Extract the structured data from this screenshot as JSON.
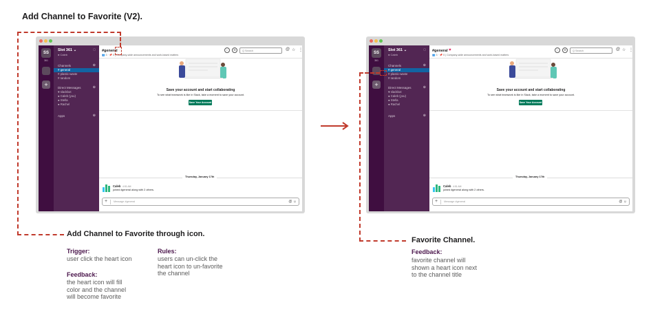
{
  "page_title": "Add Channel to Favorite (V2).",
  "mock": {
    "workspace_initials": "SS",
    "workspace_sub": "361",
    "workspace_name": "Slot 361 ⌄",
    "user_status": "● Caleb",
    "sections": {
      "channels": "Channels",
      "direct_messages": "Direct Messages",
      "apps": "Apps"
    },
    "channels": [
      "# general",
      "# plastic-waste",
      "# random"
    ],
    "dms": [
      "♥ slackbot",
      "● Caleb (you)",
      "● Stella",
      "● Rachel"
    ],
    "channel_title": "#general",
    "channel_desc": "👥 3 · 📌 0 | Company-wide announcements and work-based matters",
    "search_placeholder": "Q  Search",
    "onboarding": {
      "title": "Save your account and start collaborating",
      "body": "To see what teamwork is like in Slack, take a moment to save your account.",
      "button": "Save Your Account"
    },
    "date_divider": "Thursday, January 17th",
    "message": {
      "author": "Caleb",
      "time": "4:51 AM",
      "text": "joined #general along with 2 others."
    },
    "composer_placeholder": "Message #general"
  },
  "annotations": {
    "left": {
      "title": "Add Channel to Favorite through icon.",
      "trigger_label": "Trigger:",
      "trigger_text": [
        "user click the heart icon"
      ],
      "rules_label": "Rules:",
      "rules_text": [
        "users can un-click the",
        "heart icon to un-favorite",
        "the channel"
      ],
      "feedback_label": "Feedback:",
      "feedback_text": [
        "the heart icon will fill",
        "color and the channel",
        "will become favorite"
      ]
    },
    "right": {
      "title": "Favorite Channel.",
      "feedback_label": "Feedback:",
      "feedback_text": [
        "favorite channel will",
        "shown a heart icon next",
        "to the channel title"
      ]
    }
  },
  "colors": {
    "sidebar": "#522653",
    "rail": "#3f0e40",
    "active_channel": "#1264a3",
    "accent_button": "#007a5a",
    "annotation_red": "#c0392b",
    "heart": "#e01e5a",
    "label_purple": "#4a154b"
  }
}
